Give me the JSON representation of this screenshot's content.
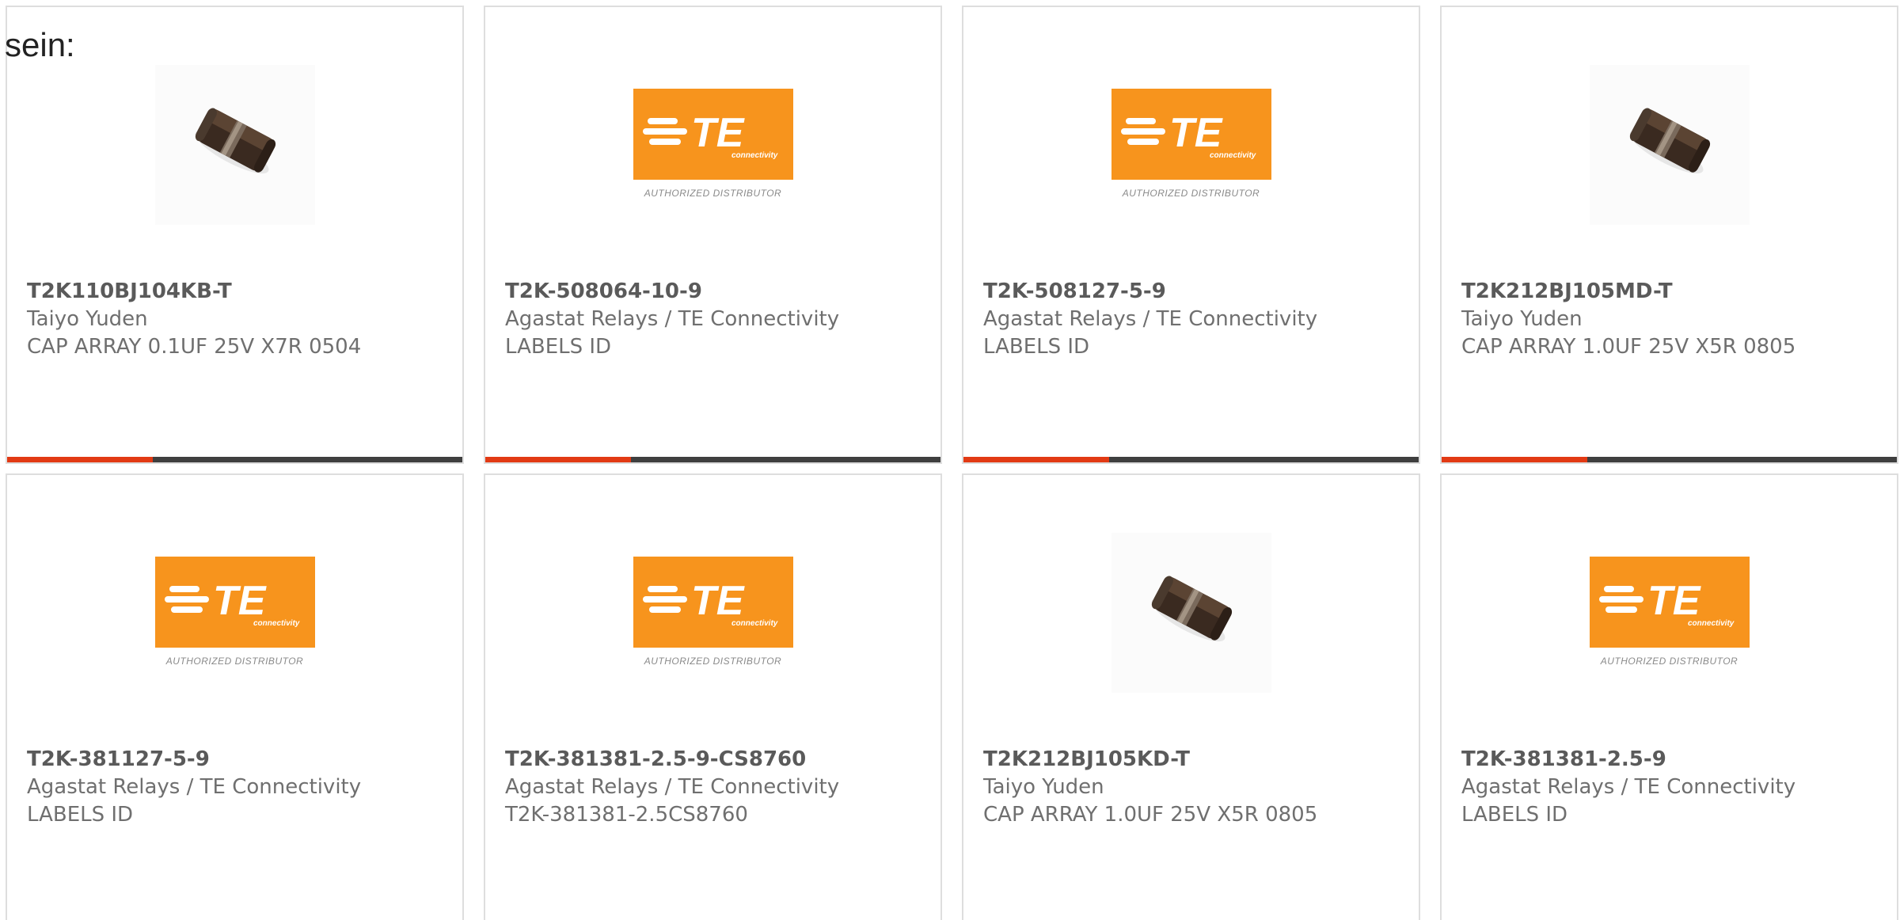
{
  "intro_text": "sein:",
  "logo_text": "TE",
  "logo_subtext": "connectivity",
  "logo_caption": "AUTHORIZED DISTRIBUTOR",
  "colors": {
    "te_orange": "#f7941d",
    "accent_red": "#e23a14",
    "bar_dark": "#3f3f3f"
  },
  "products": [
    {
      "part": "T2K110BJ104KB-T",
      "manufacturer": "Taiyo Yuden",
      "description": "CAP ARRAY 0.1UF 25V X7R 0504",
      "image": "chip-capacitor-image"
    },
    {
      "part": "T2K-508064-10-9",
      "manufacturer": "Agastat Relays / TE Connectivity",
      "description": "LABELS ID",
      "image": "te-logo"
    },
    {
      "part": "T2K-508127-5-9",
      "manufacturer": "Agastat Relays / TE Connectivity",
      "description": "LABELS ID",
      "image": "te-logo"
    },
    {
      "part": "T2K212BJ105MD-T",
      "manufacturer": "Taiyo Yuden",
      "description": "CAP ARRAY 1.0UF 25V X5R 0805",
      "image": "chip-capacitor-image"
    },
    {
      "part": "T2K-381127-5-9",
      "manufacturer": "Agastat Relays / TE Connectivity",
      "description": "LABELS ID",
      "image": "te-logo"
    },
    {
      "part": "T2K-381381-2.5-9-CS8760",
      "manufacturer": "Agastat Relays / TE Connectivity",
      "description": "T2K-381381-2.5CS8760",
      "image": "te-logo"
    },
    {
      "part": "T2K212BJ105KD-T",
      "manufacturer": "Taiyo Yuden",
      "description": "CAP ARRAY 1.0UF 25V X5R 0805",
      "image": "chip-capacitor-image"
    },
    {
      "part": "T2K-381381-2.5-9",
      "manufacturer": "Agastat Relays / TE Connectivity",
      "description": "LABELS ID",
      "image": "te-logo"
    }
  ]
}
